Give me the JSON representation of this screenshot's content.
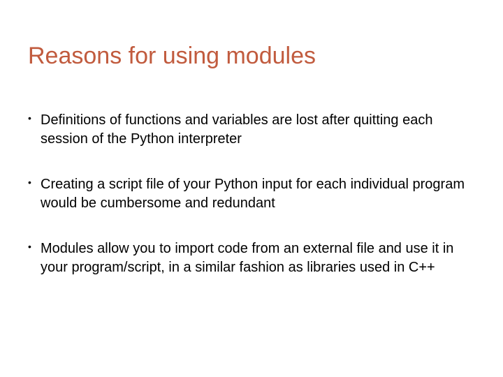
{
  "slide": {
    "title": "Reasons for using modules",
    "bullets": [
      "Definitions of functions and variables are lost after quitting each session of the Python interpreter",
      "Creating a script file of your Python input for each individual program would be cumbersome and redundant",
      "Modules allow you to import code from an external file and use it in your program/script, in a similar fashion as libraries used in C++"
    ]
  }
}
